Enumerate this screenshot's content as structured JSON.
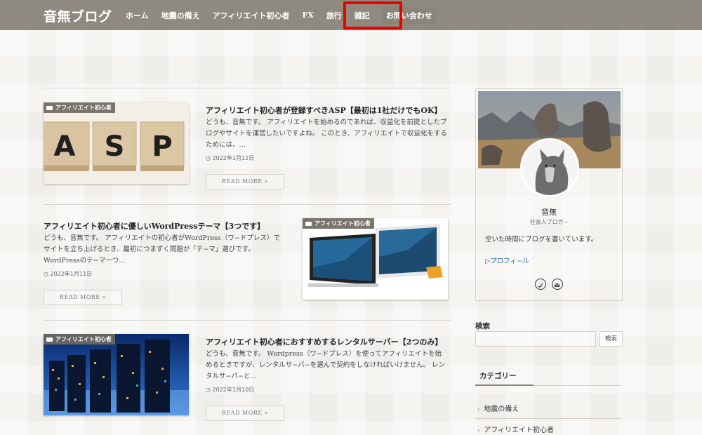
{
  "header": {
    "logo": "音無ブログ",
    "nav": [
      "ホーム",
      "地震の備え",
      "アフィリエイト初心者",
      "FX",
      "旅行",
      "雑記",
      "お問い合わせ"
    ]
  },
  "posts": [
    {
      "category": "アフィリエイト初心者",
      "title": "アフィリエイト初心者が登録すべきASP【最初は1社だけでもOK】",
      "excerpt": "どうも、音無です。 アフィリエイトを始めるのであれば、収益化を前提としたブログやサイトを運営したいですよね。 このとき、アフィリエイトで収益化をするためには、…",
      "date": "2022年1月12日",
      "more": "READ MORE »",
      "thumb_letters": [
        "A",
        "S",
        "P"
      ]
    },
    {
      "category": "アフィリエイト初心者",
      "title": "アフィリエイト初心者に優しいWordPressテーマ【3つです】",
      "excerpt": "どうも、音無です。 アフィリエイトの初心者がWordPress（ワ−ドプレス）でサイトを立ち上げるとき、最初につまずく問題が「テ−マ」選びです。 WordPressのテ−マ一つ…",
      "date": "2022年1月11日",
      "more": "READ MORE »"
    },
    {
      "category": "アフィリエイト初心者",
      "title": "アフィリエイト初心者におすすめするレンタルサーバー【2つのみ】",
      "excerpt": "どうも、音無です。 Wordpress（ワ−ドプレス）を使ってアフィリエイトを始めるときですが、レンタルサ−バ−を選んで契約をしなければいけません。 レンタルサ−バ−と…",
      "date": "2022年1月10日",
      "more": "READ MORE »"
    }
  ],
  "profile": {
    "name": "音無",
    "role": "社会人ブロガ−",
    "bio": "空いた時間にブログを書いています。",
    "link": "▷プロフィ−ル"
  },
  "search": {
    "label": "検索",
    "button": "検索",
    "placeholder": ""
  },
  "categories": {
    "heading": "カテゴリー",
    "items": [
      "地震の備え",
      "アフィリエイト初心者"
    ]
  },
  "colors": {
    "header": "#8f8a7f",
    "highlight": "#ee0000",
    "link": "#2a6bb3"
  }
}
